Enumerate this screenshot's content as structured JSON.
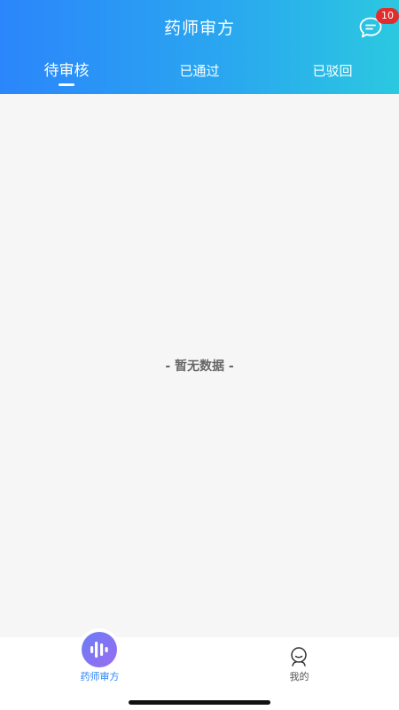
{
  "header": {
    "title": "药师审方",
    "message_badge": "10",
    "tabs": [
      {
        "label": "待审核",
        "active": true
      },
      {
        "label": "已通过",
        "active": false
      },
      {
        "label": "已驳回",
        "active": false
      }
    ]
  },
  "main": {
    "empty_text": "- 暂无数据 -"
  },
  "tabbar": {
    "items": [
      {
        "label": "药师审方",
        "icon": "audio-wave-icon",
        "active": true
      },
      {
        "label": "我的",
        "icon": "user-icon",
        "active": false
      }
    ]
  },
  "colors": {
    "header_gradient_start": "#2b86fb",
    "header_gradient_end": "#2bc8e0",
    "badge": "#e02e2e",
    "active_tab_label": "#2c86f7"
  }
}
